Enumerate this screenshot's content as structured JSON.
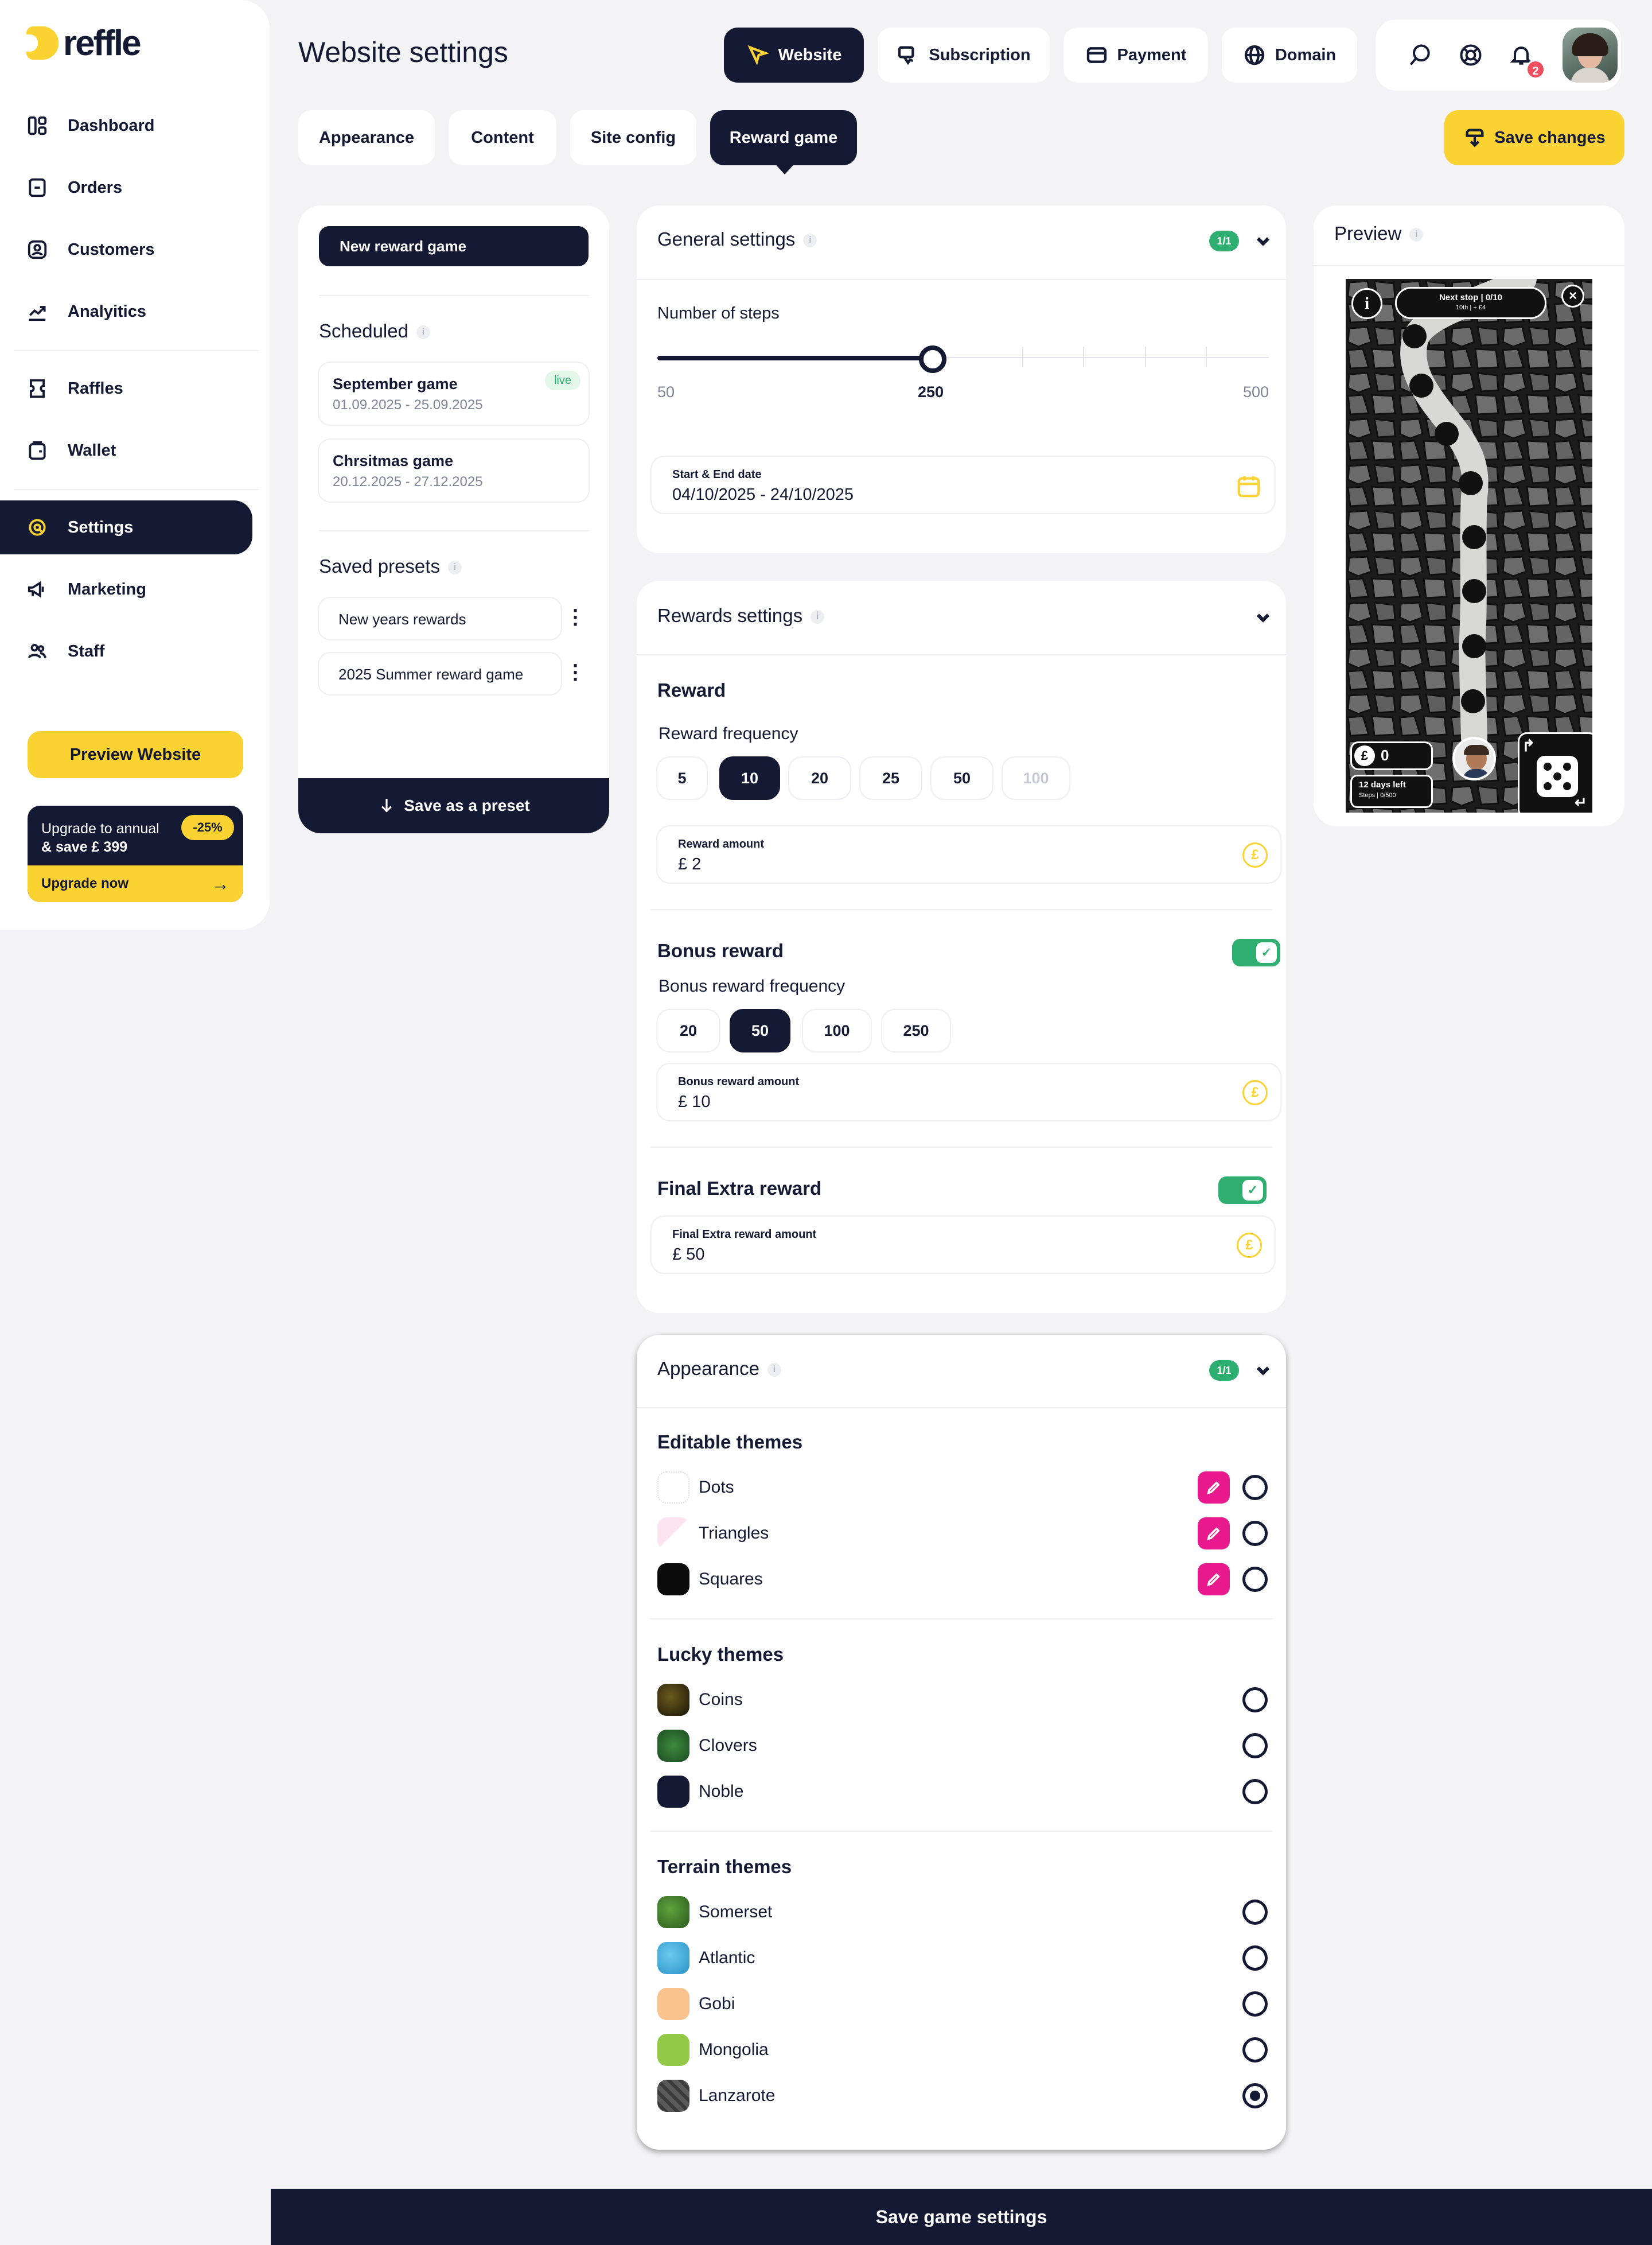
{
  "app": {
    "logo_text": "reffle"
  },
  "sidebar": {
    "items": [
      {
        "label": "Dashboard",
        "icon": "dashboard-icon"
      },
      {
        "label": "Orders",
        "icon": "orders-icon"
      },
      {
        "label": "Customers",
        "icon": "customers-icon"
      },
      {
        "label": "Analyitics",
        "icon": "analytics-icon"
      },
      {
        "label": "Raffles",
        "icon": "ticket-icon"
      },
      {
        "label": "Wallet",
        "icon": "wallet-icon"
      },
      {
        "label": "Settings",
        "icon": "settings-icon"
      },
      {
        "label": "Marketing",
        "icon": "megaphone-icon"
      },
      {
        "label": "Staff",
        "icon": "staff-icon"
      }
    ],
    "active": "Settings",
    "preview_button": "Preview Website",
    "upgrade": {
      "text_line1": "Upgrade to annual",
      "text_line2": "& save £ 399",
      "discount": "-25%",
      "cta": "Upgrade now"
    }
  },
  "header": {
    "title": "Website settings",
    "top_tabs": [
      {
        "label": "Website",
        "icon": "cursor-icon",
        "active": true
      },
      {
        "label": "Subscription",
        "icon": "subscription-icon"
      },
      {
        "label": "Payment",
        "icon": "card-icon"
      },
      {
        "label": "Domain",
        "icon": "globe-icon"
      }
    ],
    "icons": [
      "search-icon",
      "help-icon",
      "bell-icon"
    ],
    "notification_count": "2",
    "sub_tabs": [
      "Appearance",
      "Content",
      "Site config",
      "Reward game"
    ],
    "active_sub_tab": "Reward game",
    "save_changes": "Save changes"
  },
  "games_panel": {
    "new_button": "New reward game",
    "scheduled_title": "Scheduled",
    "scheduled": [
      {
        "name": "September game",
        "dates": "01.09.2025 - 25.09.2025",
        "badge": "live"
      },
      {
        "name": "Chrsitmas game",
        "dates": "20.12.2025 - 27.12.2025"
      }
    ],
    "presets_title": "Saved presets",
    "presets": [
      "New years rewards",
      "2025 Summer reward game"
    ],
    "save_preset": "Save as a preset"
  },
  "general_settings": {
    "title": "General settings",
    "badge": "1/1",
    "steps_label": "Number of steps",
    "steps_min": "50",
    "steps_value": "250",
    "steps_max": "500",
    "steps_fraction": 0.45,
    "date_label": "Start & End date",
    "date_value": "04/10/2025 - 24/10/2025"
  },
  "rewards_settings": {
    "title": "Rewards settings",
    "reward_title": "Reward",
    "frequency_label": "Reward frequency",
    "frequencies": [
      "5",
      "10",
      "20",
      "25",
      "50",
      "100"
    ],
    "frequency_selected": "10",
    "amount_label": "Reward amount",
    "amount_value": "£ 2",
    "bonus_title": "Bonus reward",
    "bonus_frequency_label": "Bonus reward frequency",
    "bonus_frequencies": [
      "20",
      "50",
      "100",
      "250"
    ],
    "bonus_selected": "50",
    "bonus_amount_label": "Bonus reward amount",
    "bonus_amount_value": "£ 10",
    "final_title": "Final Extra reward",
    "final_amount_label": "Final Extra reward amount",
    "final_amount_value": "£ 50",
    "currency_symbol": "£"
  },
  "appearance": {
    "title": "Appearance",
    "badge": "1/1",
    "editable_title": "Editable themes",
    "editable": [
      "Dots",
      "Triangles",
      "Squares"
    ],
    "lucky_title": "Lucky themes",
    "lucky": [
      "Coins",
      "Clovers",
      "Noble"
    ],
    "terrain_title": "Terrain themes",
    "terrain": [
      "Somerset",
      "Atlantic",
      "Gobi",
      "Mongolia",
      "Lanzarote"
    ],
    "selected": "Lanzarote"
  },
  "preview": {
    "title": "Preview",
    "next_stop": "Next stop | 0/10",
    "next_stop_sub": "10th | + £4",
    "coins": "0",
    "days_left": "12 days left",
    "steps": "Steps | 0/500"
  },
  "footer": {
    "save_game": "Save game settings"
  },
  "colors": {
    "navy": "#141a33",
    "yellow": "#fad232",
    "green": "#2faf6f",
    "pink": "#e8198c",
    "bg": "#f3f3f5"
  }
}
